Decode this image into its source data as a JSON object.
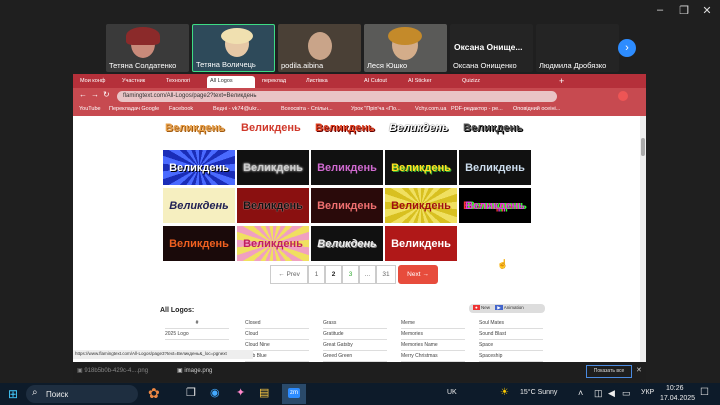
{
  "participants": [
    {
      "name": "Тетяна Солдатенко"
    },
    {
      "name": "Тетяна Воличець"
    },
    {
      "name": "podila.aibina"
    },
    {
      "name": "Леся Юшко"
    },
    {
      "name": "Оксана Онищенко"
    },
    {
      "name": "Людмила Дробязко"
    }
  ],
  "big_name": "Оксана Онище...",
  "tabs": [
    "Мои конф",
    "Участник",
    "Технологі",
    "All Logos",
    "переклад",
    "Листівка",
    "AI Cutout",
    "AI Sticker",
    "Quizizz"
  ],
  "url": "flamingtext.com/All-Logos/page2?text=Великдень",
  "bookmarks": [
    "YouTube",
    "Перекладач Google",
    "Facebook",
    "Ведні - vk74@ukr...",
    "Всеосвіта - Спільн...",
    "Урок \"Пріп'ча «По...",
    "Vchy.com.ua",
    "PDF-редактор - ре...",
    "Оповідний осеіні..."
  ],
  "logo_text": "Великдень",
  "pager": {
    "prev": "Prev",
    "next": "Next",
    "pages": [
      "1",
      "2",
      "3",
      "...",
      "31"
    ]
  },
  "section_title": "All Logos:",
  "legend": {
    "new": "New",
    "anim": "Animation"
  },
  "columns": [
    [
      "#",
      "2025 Logo"
    ],
    [
      "Closed",
      "Cloud",
      "Cloud Nine",
      "Club Blue"
    ],
    [
      "Grass",
      "Gratitude",
      "Great Gatsby",
      "Greed Green"
    ],
    [
      "Meme",
      "Memories",
      "Memories Name",
      "Merry Christmas"
    ],
    [
      "Soul Mates",
      "Sound Blast",
      "Space",
      "Spaceship"
    ]
  ],
  "status_url": "https://www.flamingtext.com/All-Logos/page3?text=Великдень&_loc=pgnext",
  "downloads": [
    "918b5b0b-429c-4....png",
    "image.png"
  ],
  "show_all": "Показать все",
  "taskbar": {
    "search": "Поиск",
    "weather": "15°C  Sunny",
    "lang": "UK",
    "kb": "УКР",
    "time": "10:26",
    "date": "17.04.2025"
  },
  "colors": {
    "browser_accent": "#b5303a",
    "next_button": "#e74c3c",
    "zoom_blue": "#2d8cff"
  }
}
